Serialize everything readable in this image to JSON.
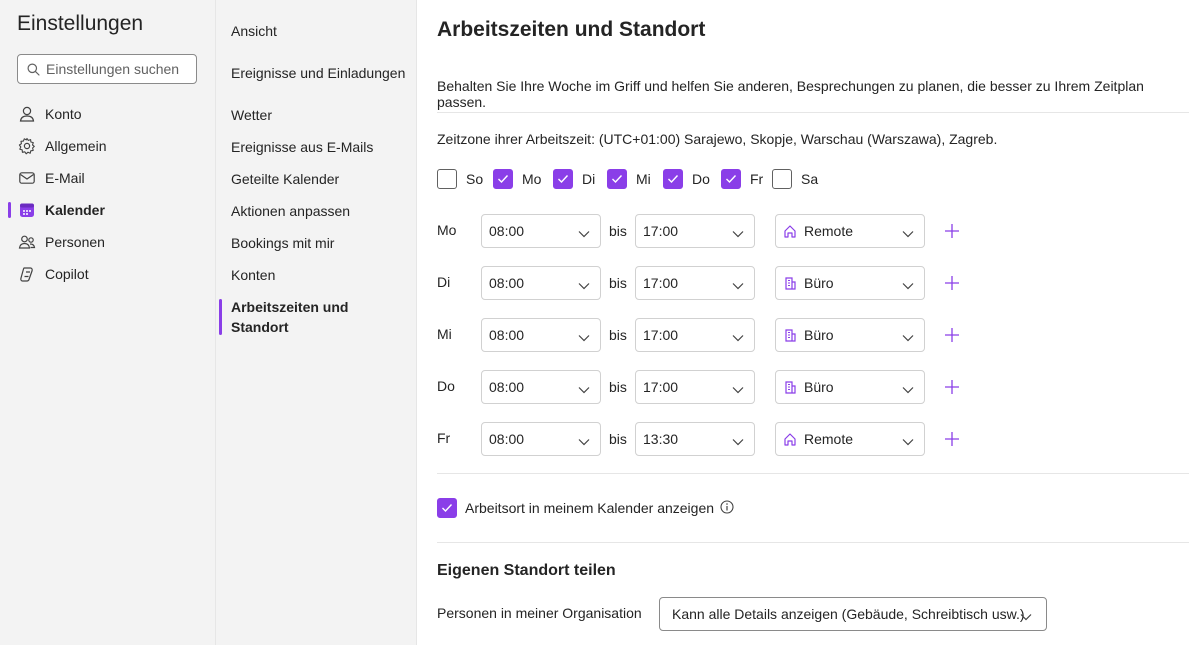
{
  "app": {
    "title": "Einstellungen"
  },
  "search": {
    "placeholder": "Einstellungen suchen"
  },
  "sidebar": {
    "items": [
      {
        "label": "Konto",
        "icon": "person-icon"
      },
      {
        "label": "Allgemein",
        "icon": "gear-icon"
      },
      {
        "label": "E-Mail",
        "icon": "mail-icon"
      },
      {
        "label": "Kalender",
        "icon": "calendar-icon",
        "active": true
      },
      {
        "label": "Personen",
        "icon": "people-icon"
      },
      {
        "label": "Copilot",
        "icon": "copilot-icon"
      }
    ]
  },
  "subnav": {
    "items": [
      {
        "label": "Ansicht"
      },
      {
        "label": "Ereignisse und Einladungen"
      },
      {
        "label": "Wetter"
      },
      {
        "label": "Ereignisse aus E-Mails"
      },
      {
        "label": "Geteilte Kalender"
      },
      {
        "label": "Aktionen anpassen"
      },
      {
        "label": "Bookings mit mir"
      },
      {
        "label": "Konten"
      },
      {
        "label": "Arbeitszeiten und Standort",
        "active": true
      }
    ]
  },
  "main": {
    "title": "Arbeitszeiten und Standort",
    "description": "Behalten Sie Ihre Woche im Griff und helfen Sie anderen, Besprechungen zu planen, die besser zu Ihrem Zeitplan passen.",
    "timezone": "Zeitzone ihrer Arbeitszeit: (UTC+01:00) Sarajewo, Skopje, Warschau (Warszawa), Zagreb.",
    "days": [
      {
        "label": "So",
        "checked": false
      },
      {
        "label": "Mo",
        "checked": true
      },
      {
        "label": "Di",
        "checked": true
      },
      {
        "label": "Mi",
        "checked": true
      },
      {
        "label": "Do",
        "checked": true
      },
      {
        "label": "Fr",
        "checked": true
      },
      {
        "label": "Sa",
        "checked": false
      }
    ],
    "bis_label": "bis",
    "rows": [
      {
        "day": "Mo",
        "start": "08:00",
        "end": "17:00",
        "location": "Remote",
        "location_icon": "home-icon"
      },
      {
        "day": "Di",
        "start": "08:00",
        "end": "17:00",
        "location": "Büro",
        "location_icon": "building-icon"
      },
      {
        "day": "Mi",
        "start": "08:00",
        "end": "17:00",
        "location": "Büro",
        "location_icon": "building-icon"
      },
      {
        "day": "Do",
        "start": "08:00",
        "end": "17:00",
        "location": "Büro",
        "location_icon": "building-icon"
      },
      {
        "day": "Fr",
        "start": "08:00",
        "end": "13:30",
        "location": "Remote",
        "location_icon": "home-icon"
      }
    ],
    "show_location_label": "Arbeitsort in meinem Kalender anzeigen",
    "show_location_checked": true,
    "share_title": "Eigenen Standort teilen",
    "org_label": "Personen in meiner Organisation",
    "org_value": "Kann alle Details anzeigen (Gebäude, Schreibtisch usw.)"
  },
  "colors": {
    "accent": "#8a3ee8",
    "sidebar_bg": "#f3f3f3"
  }
}
